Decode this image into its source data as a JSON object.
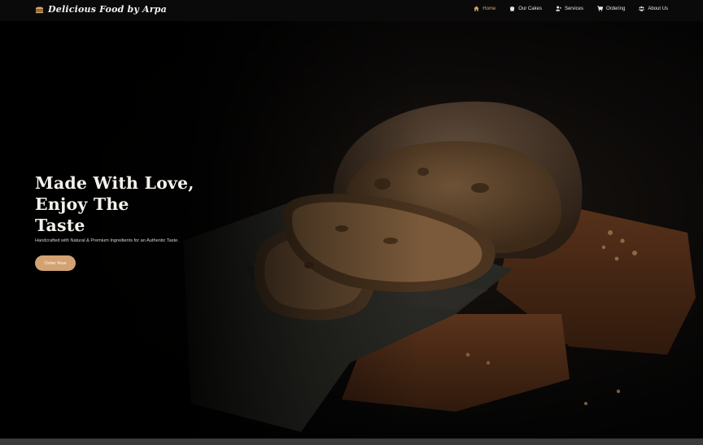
{
  "brand": {
    "name": "Delicious Food by Arpa",
    "icon": "bread-icon"
  },
  "nav": {
    "items": [
      {
        "label": "Home",
        "icon": "home-icon",
        "active": true
      },
      {
        "label": "Our Cakes",
        "icon": "cake-icon",
        "active": false
      },
      {
        "label": "Services",
        "icon": "users-icon",
        "active": false
      },
      {
        "label": "Ordering",
        "icon": "cart-icon",
        "active": false
      },
      {
        "label": "About Us",
        "icon": "group-icon",
        "active": false
      }
    ]
  },
  "hero": {
    "title_lines": [
      "Made With Love,",
      "Enjoy The",
      "Taste"
    ],
    "subtitle": "Handcrafted with Natural & Premium Ingredients for an Authentic Taste.",
    "cta_label": "Order Now"
  },
  "colors": {
    "accent": "#d9a46c",
    "button": "#d2a273",
    "background": "#050505"
  }
}
